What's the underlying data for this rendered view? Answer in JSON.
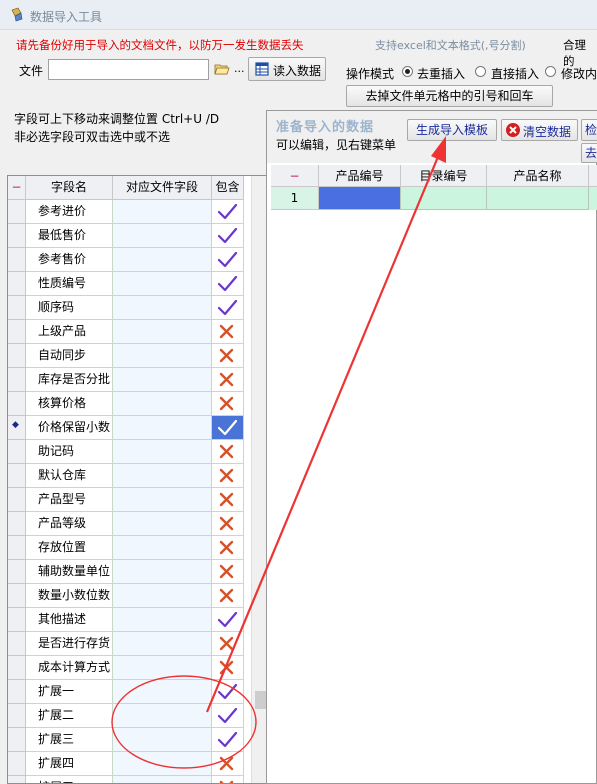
{
  "window": {
    "title": "数据导入工具"
  },
  "header": {
    "warning": "请先备份好用于导入的文档文件，以防万一发生数据丢失",
    "support": "支持excel和文本格式(,号分割)",
    "reason": "合理的"
  },
  "file": {
    "label": "文件",
    "value": "",
    "browse": "...",
    "read_button": "读入数据"
  },
  "operation": {
    "label": "操作模式",
    "options": [
      {
        "label": "去重插入",
        "selected": true
      },
      {
        "label": "直接插入",
        "selected": false
      },
      {
        "label": "修改内",
        "selected": false
      }
    ],
    "strip_button": "去掉文件单元格中的引号和回车"
  },
  "hints": {
    "line1": "字段可上下移动来调整位置 Ctrl+U /D",
    "line2": "非必选字段可双击选中或不选"
  },
  "field_grid": {
    "corner": "−",
    "columns": [
      "字段名",
      "对应文件字段",
      "包含"
    ],
    "rows": [
      {
        "name": "参考进价",
        "include": true,
        "current": false
      },
      {
        "name": "最低售价",
        "include": true,
        "current": false
      },
      {
        "name": "参考售价",
        "include": true,
        "current": false
      },
      {
        "name": "性质编号",
        "include": true,
        "current": false
      },
      {
        "name": "顺序码",
        "include": true,
        "current": false
      },
      {
        "name": "上级产品",
        "include": false,
        "current": false
      },
      {
        "name": "自动同步",
        "include": false,
        "current": false
      },
      {
        "name": "库存是否分批",
        "include": false,
        "current": false
      },
      {
        "name": "核算价格",
        "include": false,
        "current": false
      },
      {
        "name": "价格保留小数",
        "include": true,
        "current": true
      },
      {
        "name": "助记码",
        "include": false,
        "current": false
      },
      {
        "name": "默认仓库",
        "include": false,
        "current": false
      },
      {
        "name": "产品型号",
        "include": false,
        "current": false
      },
      {
        "name": "产品等级",
        "include": false,
        "current": false
      },
      {
        "name": "存放位置",
        "include": false,
        "current": false
      },
      {
        "name": "辅助数量单位",
        "include": false,
        "current": false
      },
      {
        "name": "数量小数位数",
        "include": false,
        "current": false
      },
      {
        "name": "其他描述",
        "include": true,
        "current": false
      },
      {
        "name": "是否进行存货",
        "include": false,
        "current": false
      },
      {
        "name": "成本计算方式",
        "include": false,
        "current": false
      },
      {
        "name": "扩展一",
        "include": true,
        "current": false
      },
      {
        "name": "扩展二",
        "include": true,
        "current": false
      },
      {
        "name": "扩展三",
        "include": true,
        "current": false
      },
      {
        "name": "扩展四",
        "include": false,
        "current": false
      },
      {
        "name": "扩展五",
        "include": false,
        "current": false
      }
    ]
  },
  "import_panel": {
    "title": "准备导入的数据",
    "subtitle": "可以编辑，见右键菜单",
    "gen_template_button": "生成导入模板",
    "clear_button": "清空数据",
    "check_button": "检",
    "remove_button": "去"
  },
  "data_grid": {
    "corner": "−",
    "columns": [
      "产品编号",
      "目录编号",
      "产品名称"
    ],
    "rows": [
      {
        "num": "1"
      }
    ]
  },
  "colors": {
    "check": "#6a38c8",
    "cross": "#d2532b",
    "selected": "#4a73d8",
    "annotation": "#ee3333",
    "grid_new_row": "#ccf5e0"
  }
}
